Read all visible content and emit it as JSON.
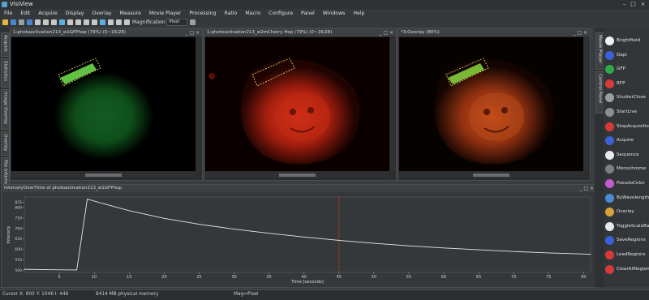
{
  "app": {
    "title": "VisiView"
  },
  "menu": [
    "File",
    "Edit",
    "Acquire",
    "Display",
    "Overlay",
    "Measure",
    "Movie Player",
    "Processing",
    "Ratio",
    "Macro",
    "Configure",
    "Panel",
    "Windows",
    "Help"
  ],
  "toolbar": {
    "magnification_label": "Magnification",
    "magnification_value": "Pixel"
  },
  "left_dock_tabs": [
    "Acquire",
    "Statistics",
    "Image Overlay",
    "Overlay",
    "File Information"
  ],
  "image_windows": [
    {
      "title": "1:photoactivation213_w1GFPhop (79%) (0~16/28)"
    },
    {
      "title": "1:photoactivation213_w2mCherry Hop (79%) (0~16/28)"
    },
    {
      "title": "*3:Overlay (80%)"
    }
  ],
  "plot_window": {
    "title": "IntensityOverTime of photoactivation213_w1GFPhop"
  },
  "chart_data": {
    "type": "line",
    "xlabel": "Time [seconds]",
    "ylabel": "Intensity",
    "xlim": [
      0,
      81
    ],
    "x_ticks": [
      5,
      10,
      15,
      20,
      25,
      30,
      35,
      40,
      45,
      50,
      55,
      60,
      65,
      70,
      75,
      80
    ],
    "y_ticks": [
      500,
      550,
      600,
      650,
      700,
      750,
      800,
      825
    ],
    "ylim": [
      490,
      850
    ],
    "marker_x": 45,
    "series": [
      {
        "x": [
          0,
          4,
          7.5,
          9,
          12,
          15,
          20,
          25,
          30,
          35,
          40,
          45,
          50,
          55,
          60,
          65,
          70,
          75,
          81
        ],
        "values": [
          505,
          503,
          502,
          840,
          812,
          785,
          748,
          720,
          697,
          677,
          659,
          643,
          629,
          617,
          607,
          598,
          590,
          583,
          577
        ]
      }
    ],
    "colors": {
      "line": "#e6e6e6",
      "marker": "#c0392b"
    }
  },
  "right_dock_tabs": [
    "Movie Player",
    "Control Panel"
  ],
  "control_panel": [
    {
      "label": "Brightfield",
      "icon": "brightfield-icon",
      "color": "#f0f0f0"
    },
    {
      "label": "Dapi",
      "icon": "dapi-icon",
      "color": "#3a62d6"
    },
    {
      "label": "GFP",
      "icon": "gfp-icon",
      "color": "#2fa84a"
    },
    {
      "label": "RFP",
      "icon": "rfp-icon",
      "color": "#d83a3a"
    },
    {
      "label": "ShutterClose",
      "icon": "shutter-close-icon",
      "color": "#9a9ea2"
    },
    {
      "label": "StartLive",
      "icon": "start-live-icon",
      "color": "#8a8f94"
    },
    {
      "label": "StopAcquisition",
      "icon": "stop-acquisition-icon",
      "color": "#d83a3a"
    },
    {
      "label": "Acquire",
      "icon": "acquire-icon",
      "color": "#3a62d6"
    },
    {
      "label": "Sequence",
      "icon": "sequence-icon",
      "color": "#e8e8e8"
    },
    {
      "label": "Monochrome",
      "icon": "monochrome-icon",
      "color": "#7d7f82"
    },
    {
      "label": "PseudoColor",
      "icon": "pseudocolor-icon",
      "color": "#c45ad0"
    },
    {
      "label": "ByWavelength",
      "icon": "by-wavelength-icon",
      "color": "#4a8ad8"
    },
    {
      "label": "Overlay",
      "icon": "overlay-icon",
      "color": "#d8a23a"
    },
    {
      "label": "ToggleScaleBar",
      "icon": "toggle-scale-bar-icon",
      "color": "#e8e8e8"
    },
    {
      "label": "SaveRegions",
      "icon": "save-regions-icon",
      "color": "#3a62d6"
    },
    {
      "label": "LoadRegions",
      "icon": "load-regions-icon",
      "color": "#d83a3a"
    },
    {
      "label": "ClearAllRegions",
      "icon": "clear-all-regions-icon",
      "color": "#d83a3a"
    }
  ],
  "status": {
    "cursor": "Cursor X: 900 Y: 1046 I: 446",
    "memory": "8414 MB physical memory",
    "mag": "Mag=Pixel"
  }
}
